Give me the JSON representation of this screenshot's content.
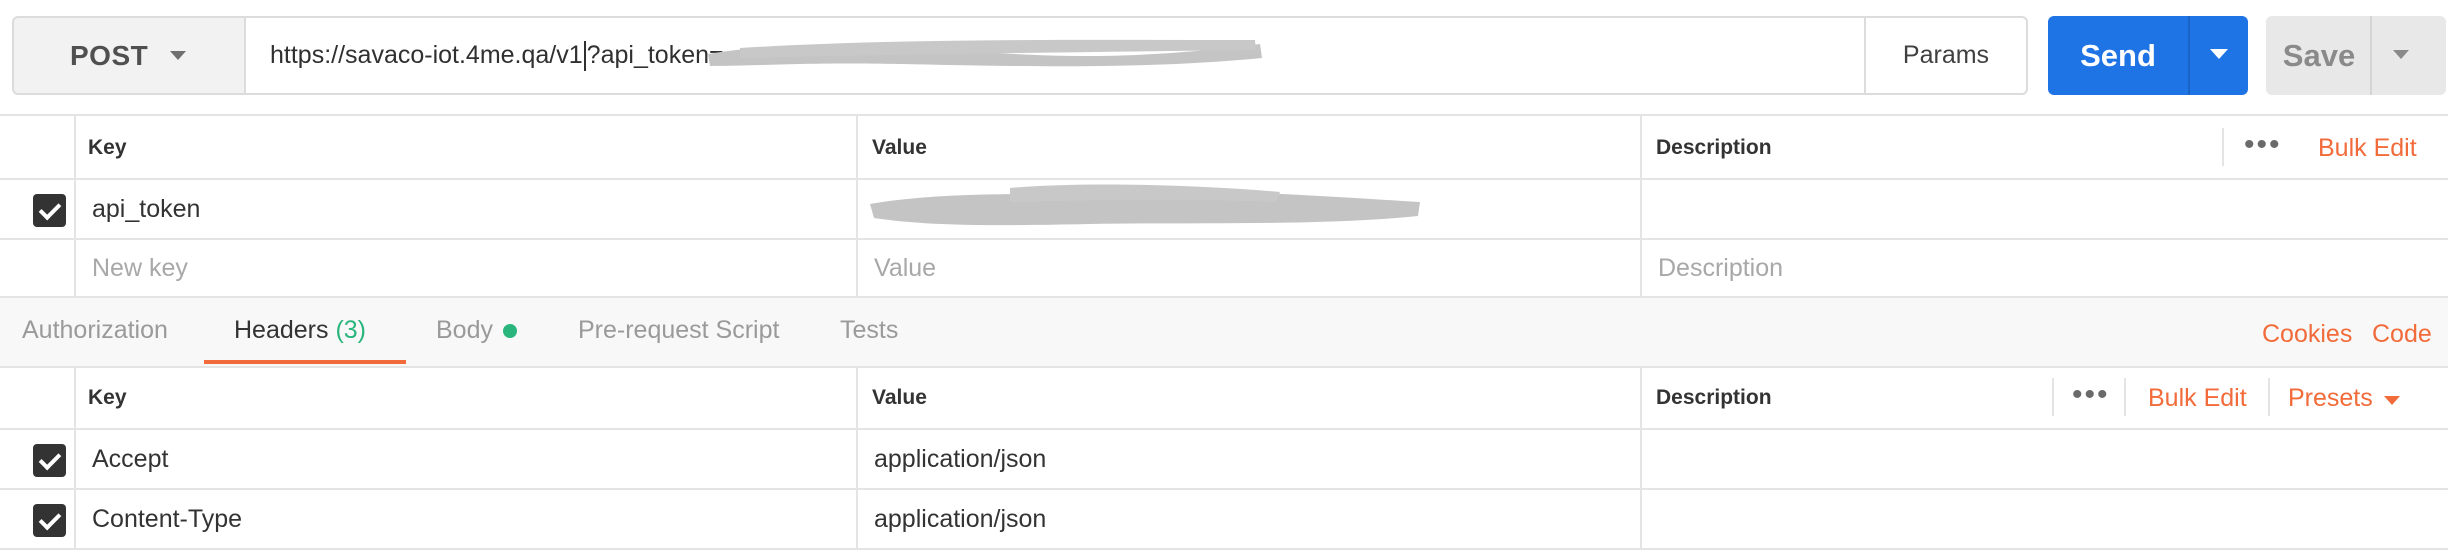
{
  "request": {
    "method": "POST",
    "url_prefix": "https://savaco-iot.4me.qa/v1",
    "url_suffix": "?api_token=",
    "params_label": "Params",
    "send_label": "Send",
    "save_label": "Save"
  },
  "params_table": {
    "columns": {
      "key": "Key",
      "value": "Value",
      "description": "Description"
    },
    "bulk_edit": "Bulk Edit",
    "rows": [
      {
        "checked": true,
        "key": "api_token",
        "value": "",
        "description": ""
      }
    ],
    "new_row": {
      "key_placeholder": "New key",
      "value_placeholder": "Value",
      "description_placeholder": "Description"
    }
  },
  "tabs": {
    "items": [
      {
        "label": "Authorization"
      },
      {
        "label": "Headers",
        "count": "(3)"
      },
      {
        "label": "Body"
      },
      {
        "label": "Pre-request Script"
      },
      {
        "label": "Tests"
      }
    ],
    "active": "Headers",
    "cookies": "Cookies",
    "code": "Code"
  },
  "headers_table": {
    "columns": {
      "key": "Key",
      "value": "Value",
      "description": "Description"
    },
    "bulk_edit": "Bulk Edit",
    "presets": "Presets",
    "rows": [
      {
        "checked": true,
        "key": "Accept",
        "value": "application/json",
        "description": ""
      },
      {
        "checked": true,
        "key": "Content-Type",
        "value": "application/json",
        "description": ""
      }
    ]
  },
  "colors": {
    "accent": "#f26b3a",
    "send": "#1e73e5",
    "status_green": "#2ab57d"
  }
}
